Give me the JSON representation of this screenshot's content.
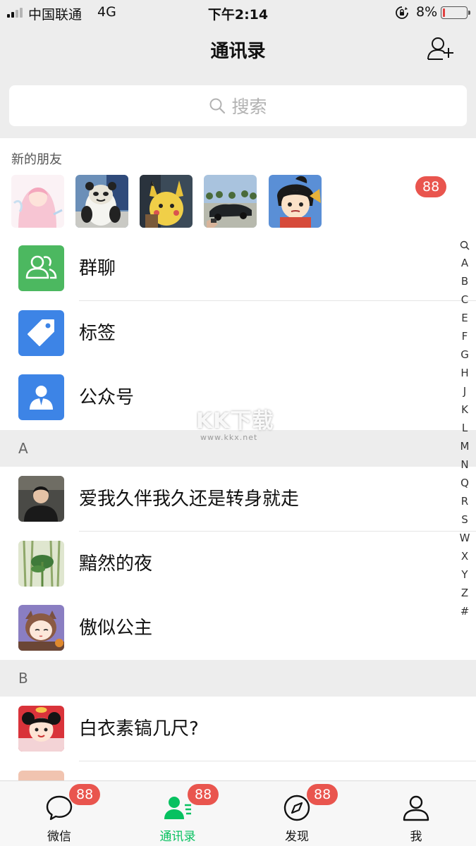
{
  "status_bar": {
    "carrier": "中国联通",
    "network": "4G",
    "time": "下午2:14",
    "battery_percent_text": "8%",
    "battery_level": 0.08,
    "signal_bars": 2
  },
  "nav": {
    "title": "通讯录",
    "add_friend_icon": "add-contact-icon"
  },
  "search": {
    "placeholder": "搜索"
  },
  "new_friends": {
    "title": "新的朋友",
    "badge": "88",
    "avatars": [
      "anime-girl-avatar",
      "panda-meme-avatar",
      "pikachu-avatar",
      "car-photo-avatar",
      "cartoon-warrior-avatar"
    ]
  },
  "functions": [
    {
      "label": "群聊",
      "icon": "group-chat-icon",
      "color": "#4cb860"
    },
    {
      "label": "标签",
      "icon": "tag-icon",
      "color": "#3d84e6"
    },
    {
      "label": "公众号",
      "icon": "official-account-icon",
      "color": "#3d84e6"
    }
  ],
  "sections": [
    {
      "letter": "A",
      "contacts": [
        {
          "name": "爱我久伴我久还是转身就走",
          "avatar": "man-photo-avatar"
        },
        {
          "name": "黯然的夜",
          "avatar": "bamboo-photo-avatar"
        },
        {
          "name": "傲似公主",
          "avatar": "cartoon-girl-avatar"
        }
      ]
    },
    {
      "letter": "B",
      "contacts": [
        {
          "name": "白衣素镐几尺?",
          "avatar": "cartoon-red-girl-avatar"
        }
      ]
    }
  ],
  "index_letters": [
    "A",
    "B",
    "C",
    "E",
    "F",
    "G",
    "H",
    "J",
    "K",
    "L",
    "M",
    "N",
    "Q",
    "R",
    "S",
    "W",
    "X",
    "Y",
    "Z",
    "#"
  ],
  "watermark": {
    "main": "KK下载",
    "sub": "www.kkx.net"
  },
  "tabs": [
    {
      "label": "微信",
      "icon": "chat-bubble-icon",
      "badge": "88",
      "active": false
    },
    {
      "label": "通讯录",
      "icon": "contacts-icon",
      "badge": "88",
      "active": true
    },
    {
      "label": "发现",
      "icon": "compass-icon",
      "badge": "88",
      "active": false
    },
    {
      "label": "我",
      "icon": "person-icon",
      "badge": "",
      "active": false
    }
  ],
  "colors": {
    "accent_green": "#07c160",
    "badge_red": "#e9554e",
    "background": "#ededed"
  }
}
